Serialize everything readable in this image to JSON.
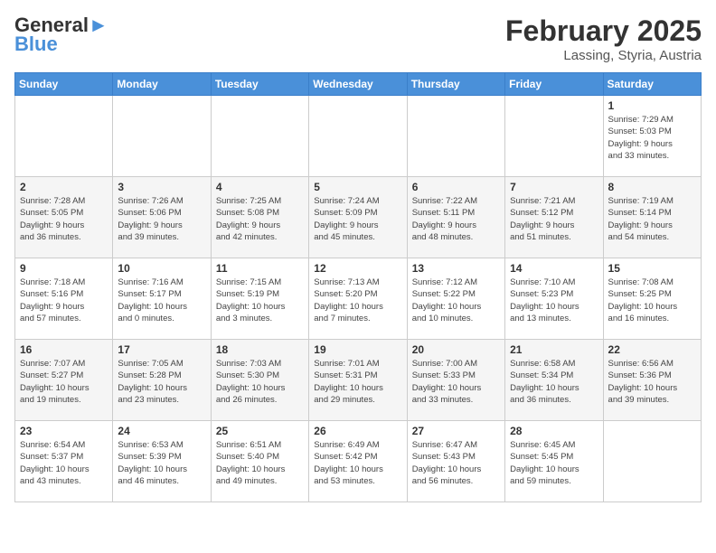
{
  "header": {
    "logo_line1": "General",
    "logo_line2": "Blue",
    "month_year": "February 2025",
    "location": "Lassing, Styria, Austria"
  },
  "weekdays": [
    "Sunday",
    "Monday",
    "Tuesday",
    "Wednesday",
    "Thursday",
    "Friday",
    "Saturday"
  ],
  "weeks": [
    [
      {
        "day": "",
        "info": ""
      },
      {
        "day": "",
        "info": ""
      },
      {
        "day": "",
        "info": ""
      },
      {
        "day": "",
        "info": ""
      },
      {
        "day": "",
        "info": ""
      },
      {
        "day": "",
        "info": ""
      },
      {
        "day": "1",
        "info": "Sunrise: 7:29 AM\nSunset: 5:03 PM\nDaylight: 9 hours\nand 33 minutes."
      }
    ],
    [
      {
        "day": "2",
        "info": "Sunrise: 7:28 AM\nSunset: 5:05 PM\nDaylight: 9 hours\nand 36 minutes."
      },
      {
        "day": "3",
        "info": "Sunrise: 7:26 AM\nSunset: 5:06 PM\nDaylight: 9 hours\nand 39 minutes."
      },
      {
        "day": "4",
        "info": "Sunrise: 7:25 AM\nSunset: 5:08 PM\nDaylight: 9 hours\nand 42 minutes."
      },
      {
        "day": "5",
        "info": "Sunrise: 7:24 AM\nSunset: 5:09 PM\nDaylight: 9 hours\nand 45 minutes."
      },
      {
        "day": "6",
        "info": "Sunrise: 7:22 AM\nSunset: 5:11 PM\nDaylight: 9 hours\nand 48 minutes."
      },
      {
        "day": "7",
        "info": "Sunrise: 7:21 AM\nSunset: 5:12 PM\nDaylight: 9 hours\nand 51 minutes."
      },
      {
        "day": "8",
        "info": "Sunrise: 7:19 AM\nSunset: 5:14 PM\nDaylight: 9 hours\nand 54 minutes."
      }
    ],
    [
      {
        "day": "9",
        "info": "Sunrise: 7:18 AM\nSunset: 5:16 PM\nDaylight: 9 hours\nand 57 minutes."
      },
      {
        "day": "10",
        "info": "Sunrise: 7:16 AM\nSunset: 5:17 PM\nDaylight: 10 hours\nand 0 minutes."
      },
      {
        "day": "11",
        "info": "Sunrise: 7:15 AM\nSunset: 5:19 PM\nDaylight: 10 hours\nand 3 minutes."
      },
      {
        "day": "12",
        "info": "Sunrise: 7:13 AM\nSunset: 5:20 PM\nDaylight: 10 hours\nand 7 minutes."
      },
      {
        "day": "13",
        "info": "Sunrise: 7:12 AM\nSunset: 5:22 PM\nDaylight: 10 hours\nand 10 minutes."
      },
      {
        "day": "14",
        "info": "Sunrise: 7:10 AM\nSunset: 5:23 PM\nDaylight: 10 hours\nand 13 minutes."
      },
      {
        "day": "15",
        "info": "Sunrise: 7:08 AM\nSunset: 5:25 PM\nDaylight: 10 hours\nand 16 minutes."
      }
    ],
    [
      {
        "day": "16",
        "info": "Sunrise: 7:07 AM\nSunset: 5:27 PM\nDaylight: 10 hours\nand 19 minutes."
      },
      {
        "day": "17",
        "info": "Sunrise: 7:05 AM\nSunset: 5:28 PM\nDaylight: 10 hours\nand 23 minutes."
      },
      {
        "day": "18",
        "info": "Sunrise: 7:03 AM\nSunset: 5:30 PM\nDaylight: 10 hours\nand 26 minutes."
      },
      {
        "day": "19",
        "info": "Sunrise: 7:01 AM\nSunset: 5:31 PM\nDaylight: 10 hours\nand 29 minutes."
      },
      {
        "day": "20",
        "info": "Sunrise: 7:00 AM\nSunset: 5:33 PM\nDaylight: 10 hours\nand 33 minutes."
      },
      {
        "day": "21",
        "info": "Sunrise: 6:58 AM\nSunset: 5:34 PM\nDaylight: 10 hours\nand 36 minutes."
      },
      {
        "day": "22",
        "info": "Sunrise: 6:56 AM\nSunset: 5:36 PM\nDaylight: 10 hours\nand 39 minutes."
      }
    ],
    [
      {
        "day": "23",
        "info": "Sunrise: 6:54 AM\nSunset: 5:37 PM\nDaylight: 10 hours\nand 43 minutes."
      },
      {
        "day": "24",
        "info": "Sunrise: 6:53 AM\nSunset: 5:39 PM\nDaylight: 10 hours\nand 46 minutes."
      },
      {
        "day": "25",
        "info": "Sunrise: 6:51 AM\nSunset: 5:40 PM\nDaylight: 10 hours\nand 49 minutes."
      },
      {
        "day": "26",
        "info": "Sunrise: 6:49 AM\nSunset: 5:42 PM\nDaylight: 10 hours\nand 53 minutes."
      },
      {
        "day": "27",
        "info": "Sunrise: 6:47 AM\nSunset: 5:43 PM\nDaylight: 10 hours\nand 56 minutes."
      },
      {
        "day": "28",
        "info": "Sunrise: 6:45 AM\nSunset: 5:45 PM\nDaylight: 10 hours\nand 59 minutes."
      },
      {
        "day": "",
        "info": ""
      }
    ]
  ]
}
